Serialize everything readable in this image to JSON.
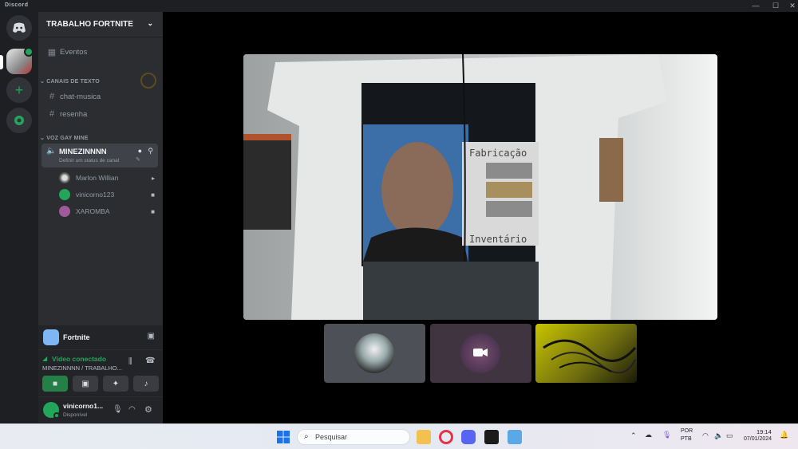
{
  "window": {
    "title": "Discord",
    "minimize": "—",
    "maximize": "☐",
    "close": "✕"
  },
  "server": {
    "name": "TRABALHO FORTNITE"
  },
  "sidebar": {
    "events_label": "Eventos",
    "text_category": "CANAIS DE TEXTO",
    "text_channels": [
      {
        "label": "chat-musica"
      },
      {
        "label": "resenha"
      }
    ],
    "voice_category": "VOZ GAY MINE",
    "voice_channel": {
      "name": "MINEZINNNN",
      "status_placeholder": "Definir um status de canal"
    },
    "members": [
      {
        "name": "Marlon Willian"
      },
      {
        "name": "vinicorno123"
      },
      {
        "name": "XAROMBA"
      }
    ]
  },
  "activity": {
    "game": "Fortnite"
  },
  "voice_panel": {
    "status": "Vídeo conectado",
    "location": "MINEZINNNN / TRABALHO..."
  },
  "user": {
    "name": "vinicorno1...",
    "status": "Disponível"
  },
  "taskbar": {
    "search_placeholder": "Pesquisar",
    "lang_top": "POR",
    "lang_bottom": "PTB",
    "time": "19:14",
    "date": "07/01/2024"
  },
  "colors": {
    "rail_bg": "#1e1f22",
    "sidebar_bg": "#2b2d31",
    "voice_connected": "#23a55a",
    "accent_green": "#248046",
    "blurple": "#5865f2"
  }
}
